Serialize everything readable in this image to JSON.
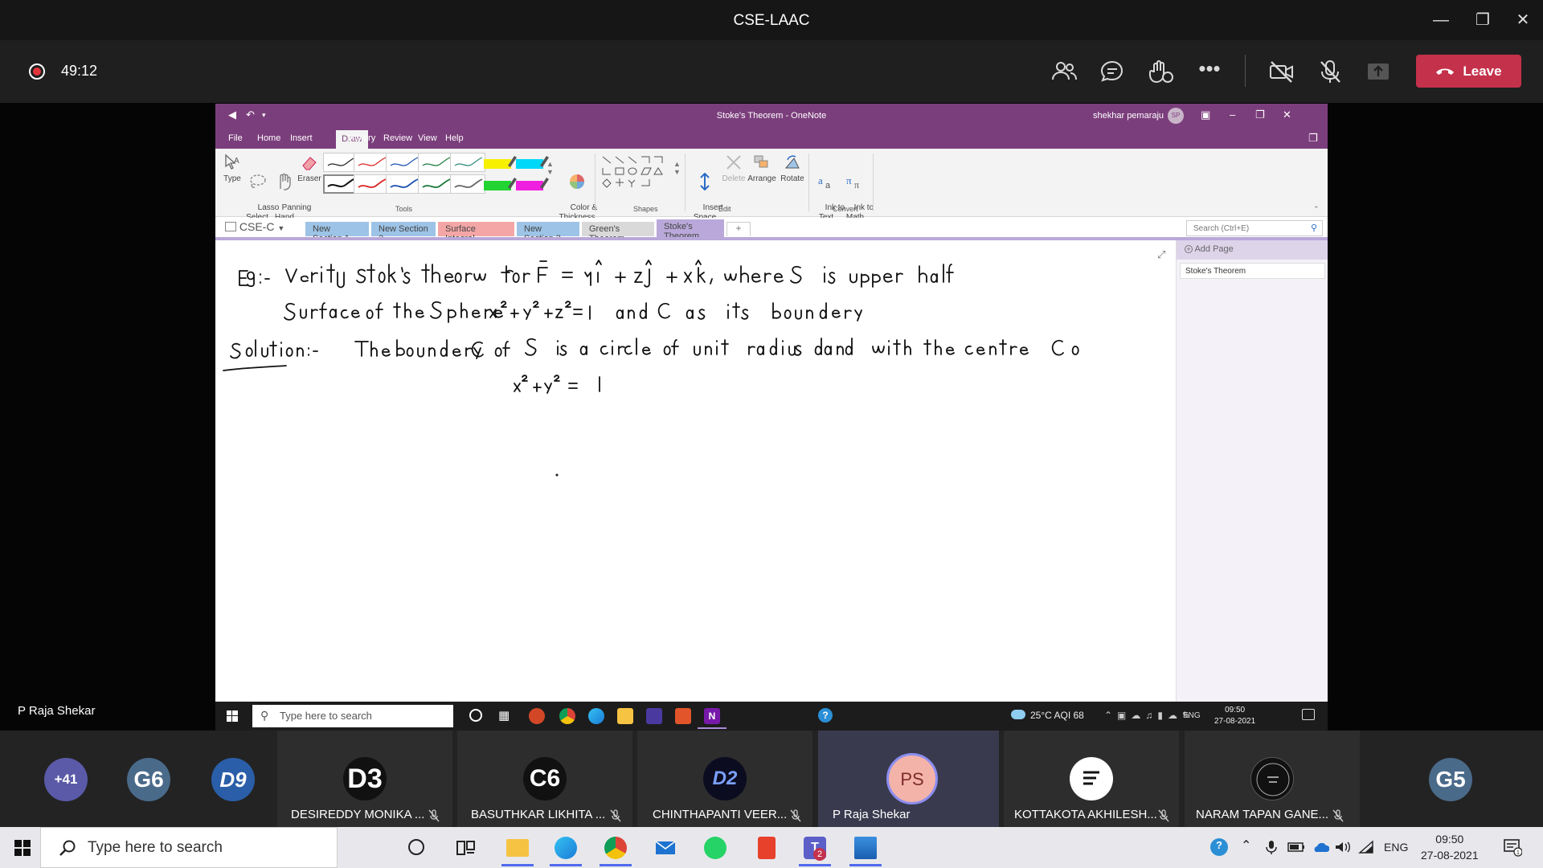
{
  "teams": {
    "window_title": "CSE-LAAC",
    "timer": "49:12",
    "leave_label": "Leave",
    "presenter_label": "P Raja Shekar"
  },
  "onenote": {
    "window_title": "Stoke's Theorem  -  OneNote",
    "user_name": "shekhar pemaraju",
    "user_initials": "SP",
    "menu": [
      "File",
      "Home",
      "Insert",
      "Draw",
      "History",
      "Review",
      "View",
      "Help"
    ],
    "ribbon": {
      "type": "Type",
      "lasso": "Lasso\nSelect",
      "panning": "Panning\nHand",
      "eraser": "Eraser",
      "color_thickness": "Color &\nThickness",
      "insert_space": "Insert\nSpace",
      "delete": "Delete",
      "arrange": "Arrange",
      "rotate": "Rotate",
      "ink_to_text": "Ink to\nText",
      "ink_to_math": "Ink to\nMath",
      "group_tools": "Tools",
      "group_shapes": "Shapes",
      "group_edit": "Edit",
      "group_convert": "Convert"
    },
    "notebook": "CSE-C",
    "sections": [
      {
        "label": "New Section 1",
        "color": "#9dc3e6"
      },
      {
        "label": "New Section 2",
        "color": "#9dc3e6"
      },
      {
        "label": "Surface Integral",
        "color": "#f4a6a6"
      },
      {
        "label": "New Section 3",
        "color": "#9dc3e6"
      },
      {
        "label": "Green's Theorem",
        "color": "#d9d9d9"
      },
      {
        "label": "Stoke's Theorem",
        "color": "#b9a8d9"
      }
    ],
    "search_placeholder": "Search (Ctrl+E)",
    "add_page": "Add Page",
    "page_title": "Stoke's Theorem"
  },
  "remote_taskbar": {
    "search_placeholder": "Type here to search",
    "weather": "25°C  AQI 68",
    "lang": "ENG",
    "time": "09:50",
    "date": "27-08-2021"
  },
  "participants": {
    "overflow": "+41",
    "small": [
      {
        "initials": "G6",
        "color": "#4a6a8a"
      },
      {
        "initials": "D9",
        "color": "#2a5ea8"
      },
      {
        "initials": "G5",
        "color": "#4a6a8a"
      }
    ],
    "tiles": [
      {
        "initials": "D3",
        "name": "DESIREDDY MONIKA ..."
      },
      {
        "initials": "C6",
        "name": "BASUTHKAR LIKHITA ..."
      },
      {
        "initials": "D2",
        "name": "CHINTHAPANTI VEER..."
      },
      {
        "initials": "PS",
        "name": "P Raja Shekar"
      },
      {
        "initials": "",
        "name": "KOTTAKOTA AKHILESH..."
      },
      {
        "initials": "",
        "name": "NARAM TAPAN GANE..."
      }
    ]
  },
  "taskbar": {
    "search_placeholder": "Type here to search",
    "lang": "ENG",
    "time": "09:50",
    "date": "27-08-2021"
  }
}
